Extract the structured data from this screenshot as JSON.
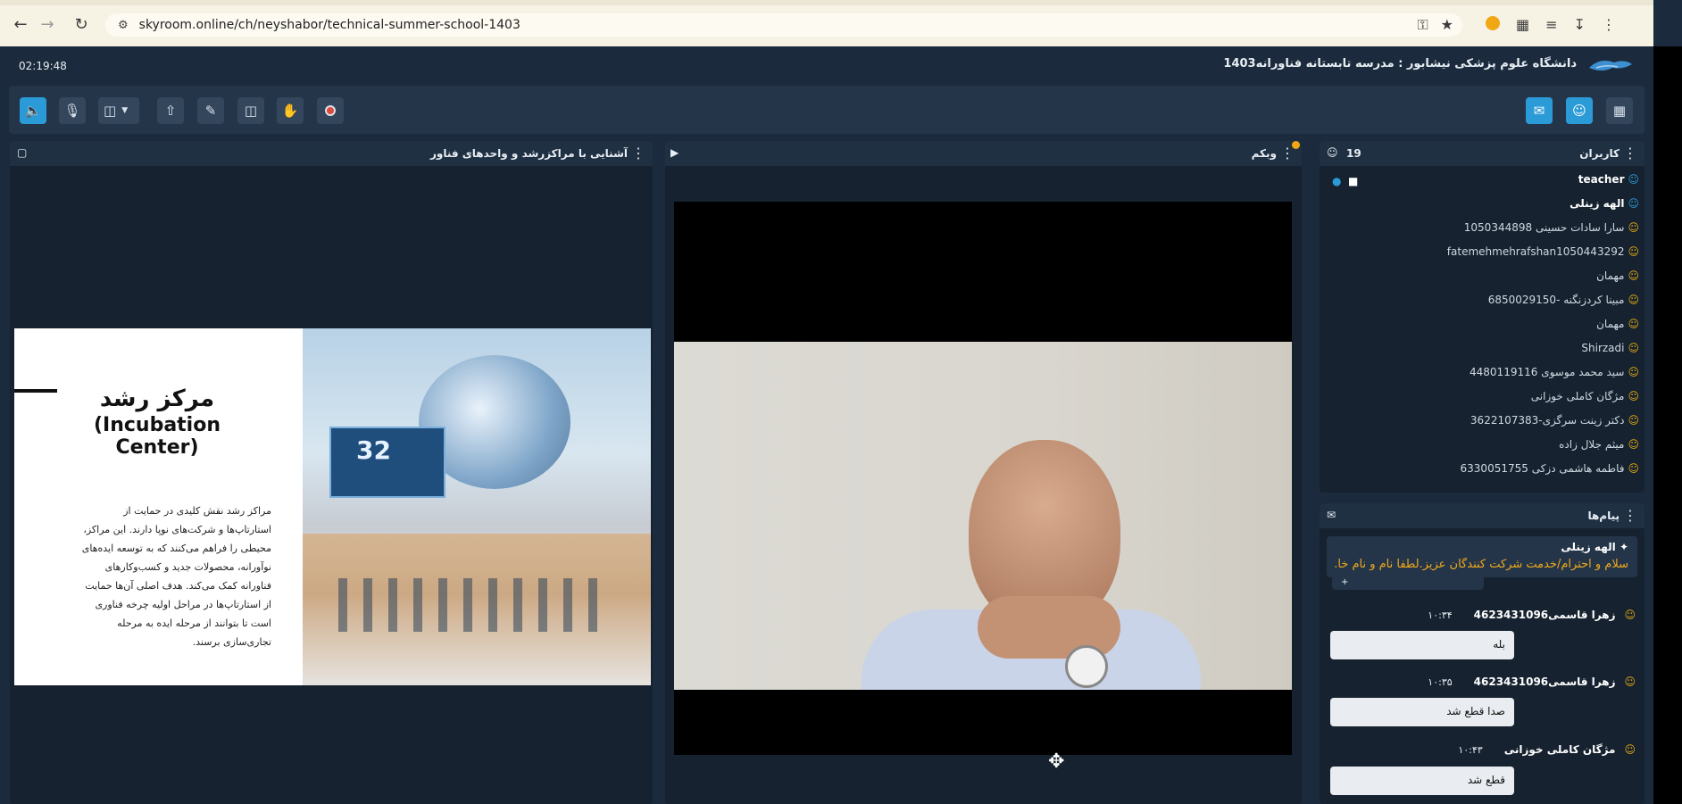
{
  "browser": {
    "url": "skyroom.online/ch/neyshabor/technical-summer-school-1403",
    "back_icon": "back-arrow-icon",
    "forward_icon": "forward-arrow-icon",
    "reload_icon": "reload-icon"
  },
  "header": {
    "clock": "02:19:48",
    "title": "دانشگاه علوم پزشکی نیشابور : مدرسه تابستانه فناورانه1403"
  },
  "slide_panel": {
    "title": "آشنایی با مراکزرشد و واحدهای فناور",
    "slide_title_fa": "مرکز رشد",
    "slide_title_en": "(Incubation Center)",
    "slide_number_text": "32",
    "slide_text": "مراکز رشد نقش کلیدی در حمایت از استارتاپ‌ها و شرکت‌های نوپا دارند. این مراکز، محیطی را فراهم می‌کنند که به توسعه ایده‌های نوآورانه، محصولات جدید و کسب‌وکارهای فناورانه کمک می‌کند. هدف اصلی آن‌ها حمایت از استارتاپ‌ها در مراحل اولیه چرخه فناوری است تا بتوانند از مرحله ایده به مرحله تجاری‌سازی برسند."
  },
  "webcam_panel": {
    "title": "وبکم"
  },
  "users_panel": {
    "title": "کاربران",
    "count": "19",
    "users": [
      {
        "name": "teacher",
        "role": "host"
      },
      {
        "name": "الهه زینلی",
        "role": "host"
      },
      {
        "name": "سارا سادات حسینی 1050344898",
        "role": "guest"
      },
      {
        "name": "fatemehmehrafshan1050443292",
        "role": "guest"
      },
      {
        "name": "مهمان",
        "role": "guest"
      },
      {
        "name": "مبینا کردزنگنه -6850029150",
        "role": "guest"
      },
      {
        "name": "مهمان",
        "role": "guest"
      },
      {
        "name": "Shirzadi",
        "role": "guest"
      },
      {
        "name": "سید محمد موسوی 4480119116",
        "role": "guest"
      },
      {
        "name": "مژگان کاملی خوزانی",
        "role": "guest"
      },
      {
        "name": "دکتر زینت سرگزی-3622107383",
        "role": "guest"
      },
      {
        "name": "میثم جلال زاده",
        "role": "guest"
      },
      {
        "name": "فاطمه هاشمی دزکی 6330051755",
        "role": "guest"
      }
    ]
  },
  "messages_panel": {
    "title": "پیام‌ها",
    "pinned": {
      "sender": "الهه زینلی",
      "text": "سلام و احترام/خدمت شرکت کنندگان عزیز.لطفا نام و نام خا..."
    },
    "plus": "+",
    "messages": [
      {
        "sender": "زهرا قاسمی4623431096",
        "time": "۱۰:۳۴",
        "text": "بله"
      },
      {
        "sender": "زهرا قاسمی4623431096",
        "time": "۱۰:۳۵",
        "text": "صدا قطع شد"
      },
      {
        "sender": "مژگان کاملی خوزانی",
        "time": "۱۰:۴۳",
        "text": "قطع شد"
      }
    ]
  },
  "colors": {
    "background": "#1b2a3c",
    "panel": "#16222f",
    "accent": "#2b9bd8",
    "guest_icon": "#e1a814",
    "pinned_text": "#f0a91d"
  }
}
